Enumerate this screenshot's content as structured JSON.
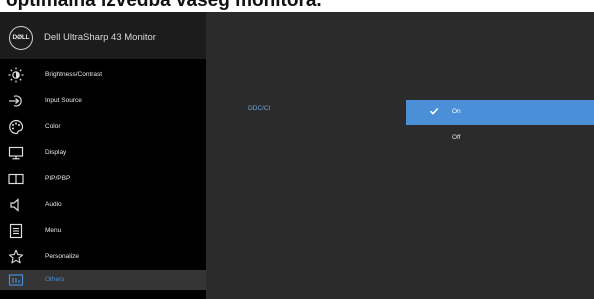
{
  "caption": "optimalna izvedba vašeg monitora.",
  "header": {
    "logo": "DØLL",
    "model": "Dell UltraSharp 43 Monitor"
  },
  "menu": {
    "items": [
      {
        "label": "Brightness/Contrast",
        "icon": "brightness-icon"
      },
      {
        "label": "Input Source",
        "icon": "input-source-icon"
      },
      {
        "label": "Color",
        "icon": "color-icon"
      },
      {
        "label": "Display",
        "icon": "display-icon"
      },
      {
        "label": "PIP/PBP",
        "icon": "pip-pbp-icon"
      },
      {
        "label": "Audio",
        "icon": "audio-icon"
      },
      {
        "label": "Menu",
        "icon": "menu-icon"
      },
      {
        "label": "Personalize",
        "icon": "star-icon"
      },
      {
        "label": "Others",
        "icon": "others-icon",
        "selected": true
      }
    ]
  },
  "panel": {
    "option_label": "DDC/CI",
    "choices": [
      {
        "label": "On",
        "selected": true
      },
      {
        "label": "Off",
        "selected": false
      }
    ]
  },
  "colors": {
    "accent": "#4a8fd8",
    "sidebar": "#000000",
    "panel": "#2b2b2b"
  }
}
